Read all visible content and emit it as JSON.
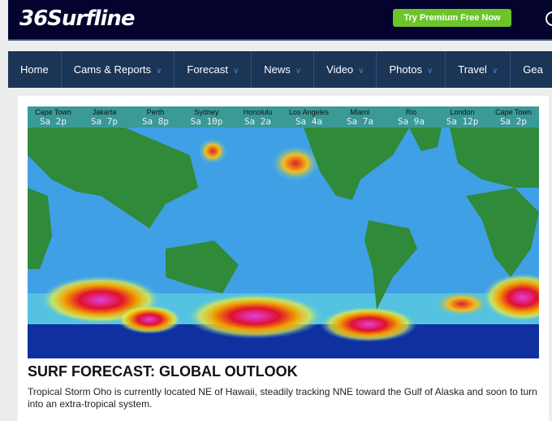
{
  "header": {
    "logo": "36Surfline",
    "premium_button": "Try Premium Free Now"
  },
  "nav": {
    "items": [
      {
        "label": "Home",
        "dropdown": false
      },
      {
        "label": "Cams & Reports",
        "dropdown": true
      },
      {
        "label": "Forecast",
        "dropdown": true
      },
      {
        "label": "News",
        "dropdown": true
      },
      {
        "label": "Video",
        "dropdown": true
      },
      {
        "label": "Photos",
        "dropdown": true
      },
      {
        "label": "Travel",
        "dropdown": true
      },
      {
        "label": "Gea",
        "dropdown": false
      }
    ]
  },
  "map": {
    "locations": [
      {
        "city": "Cape Town",
        "time": "Sa 2p"
      },
      {
        "city": "Jakarta",
        "time": "Sa 7p"
      },
      {
        "city": "Perth",
        "time": "Sa 8p"
      },
      {
        "city": "Sydney",
        "time": "Sa 10p"
      },
      {
        "city": "Honolulu",
        "time": "Sa 2a"
      },
      {
        "city": "Los Angeles",
        "time": "Sa 4a"
      },
      {
        "city": "Miami",
        "time": "Sa 7a"
      },
      {
        "city": "Rio",
        "time": "Sa 9a"
      },
      {
        "city": "London",
        "time": "Sa 12p"
      },
      {
        "city": "Cape Town",
        "time": "Sa 2p"
      }
    ]
  },
  "article": {
    "title": "SURF FORECAST: GLOBAL OUTLOOK",
    "description": "Tropical Storm Oho is currently located NE of Hawaii, steadily tracking NNE toward the Gulf of Alaska and soon to turn into an extra-tropical system."
  }
}
